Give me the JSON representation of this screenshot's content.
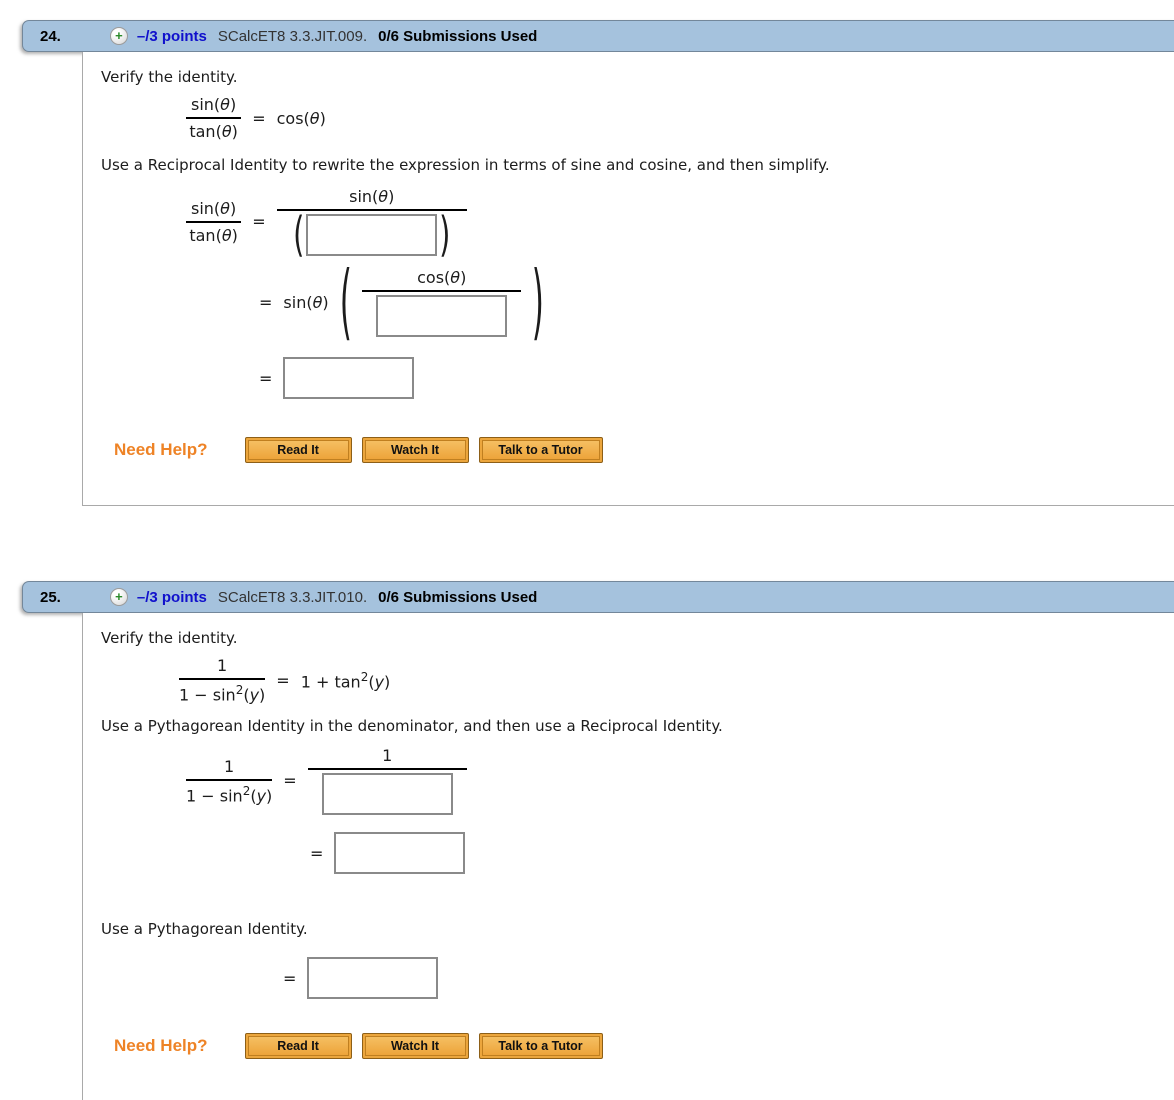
{
  "sym": {
    "plus_icon": "+",
    "sin_o": "sin(",
    "tan_o": "tan(",
    "cos_o": "cos(",
    "theta": "θ",
    "y": "y",
    "lp": "(",
    "cp": ")",
    "eq": "=",
    "one": "1",
    "two": "2",
    "one_plus_tan": "1 + tan",
    "one_minus_sin": "1 − sin"
  },
  "problems": [
    {
      "number": "24.",
      "points": "–/3 points",
      "source": "SCalcET8 3.3.JIT.009.",
      "submissions": "0/6 Submissions Used",
      "verify": "Verify the identity.",
      "instruction": "Use a Reciprocal Identity to rewrite the expression in terms of sine and cosine, and then simplify.",
      "need_help": "Need Help?",
      "buttons": {
        "read": "Read It",
        "watch": "Watch It",
        "tutor": "Talk to a Tutor"
      }
    },
    {
      "number": "25.",
      "points": "–/3 points",
      "source": "SCalcET8 3.3.JIT.010.",
      "submissions": "0/6 Submissions Used",
      "verify": "Verify the identity.",
      "instruction": "Use a Pythagorean Identity in the denominator, and then use a Reciprocal Identity.",
      "instruction2": "Use a Pythagorean Identity.",
      "need_help": "Need Help?",
      "buttons": {
        "read": "Read It",
        "watch": "Watch It",
        "tutor": "Talk to a Tutor"
      }
    }
  ],
  "colors": {
    "header_bg": "#a5c2dd",
    "header_border": "#73879a",
    "points_blue": "#1010cc",
    "help_orange": "#ee8326",
    "button_orange": "#eca63d",
    "answer_border": "#8a8a8a"
  }
}
